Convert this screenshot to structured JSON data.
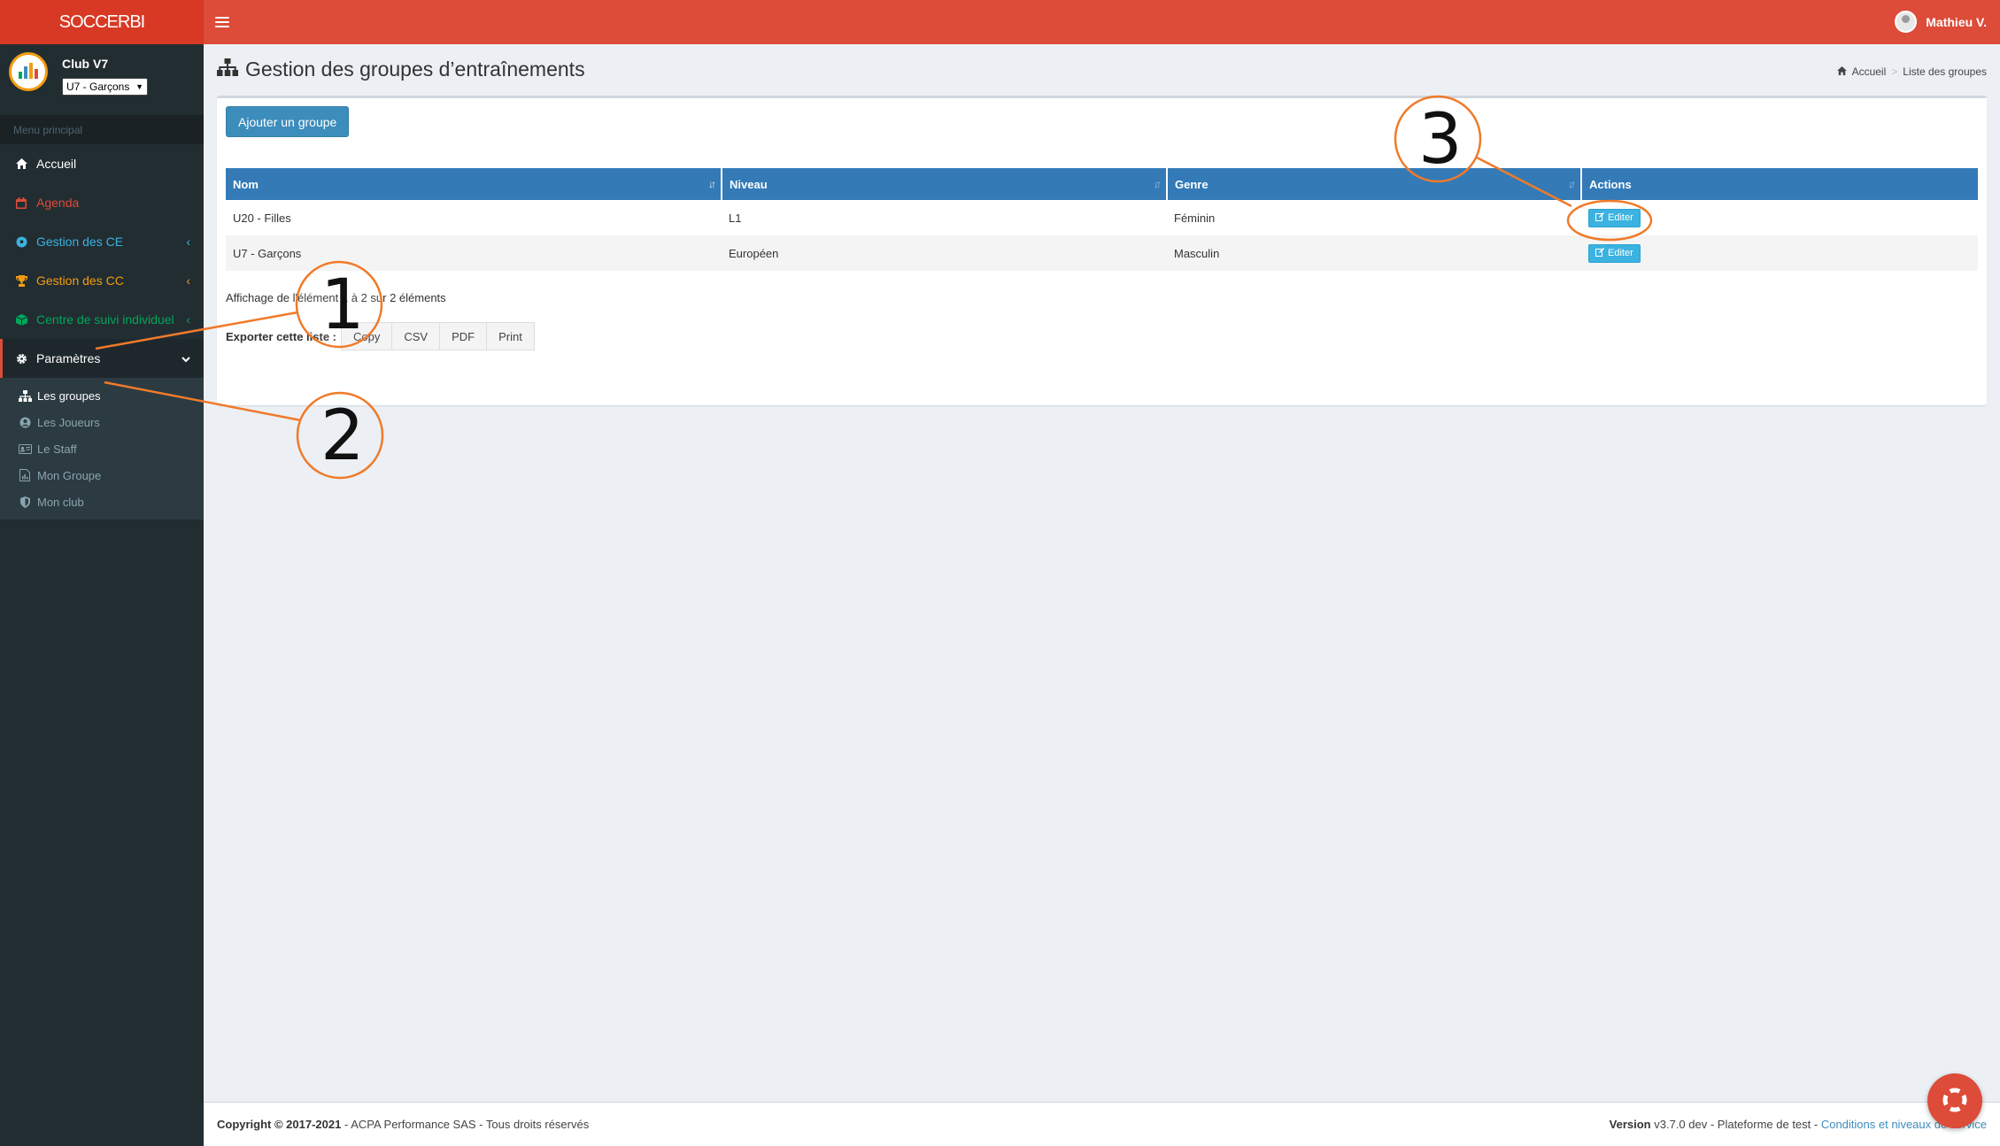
{
  "header": {
    "logo": "SOCCERBI",
    "user_name": "Mathieu V."
  },
  "sidebar": {
    "club_name": "Club V7",
    "team_select": "U7 - Garçons",
    "menu_header": "Menu principal",
    "items": [
      {
        "label": "Accueil",
        "icon": "home-icon",
        "color": "#ffffff"
      },
      {
        "label": "Agenda",
        "icon": "calendar-icon",
        "color": "#dd4b39"
      },
      {
        "label": "Gestion des CE",
        "icon": "soccer-ball-icon",
        "color": "#3bb2e0"
      },
      {
        "label": "Gestion des CC",
        "icon": "trophy-icon",
        "color": "#f39c12"
      },
      {
        "label": "Centre de suivi individuel",
        "icon": "cube-icon",
        "color": "#00a65a"
      },
      {
        "label": "Paramètres",
        "icon": "gear-icon",
        "color": "#ffffff"
      }
    ],
    "submenu": [
      {
        "label": "Les groupes",
        "icon": "sitemap-icon"
      },
      {
        "label": "Les Joueurs",
        "icon": "user-circle-icon"
      },
      {
        "label": "Le Staff",
        "icon": "id-card-icon"
      },
      {
        "label": "Mon Groupe",
        "icon": "chart-file-icon"
      },
      {
        "label": "Mon club",
        "icon": "shield-icon"
      }
    ]
  },
  "page": {
    "title": "Gestion des groupes d’entraînements",
    "breadcrumb": [
      "Accueil",
      "Liste des groupes"
    ],
    "add_button": "Ajouter un groupe"
  },
  "table": {
    "columns": [
      "Nom",
      "Niveau",
      "Genre",
      "Actions"
    ],
    "rows": [
      {
        "nom": "U20 - Filles",
        "niveau": "L1",
        "genre": "Féminin",
        "action": "Editer"
      },
      {
        "nom": "U7 - Garçons",
        "niveau": "Européen",
        "genre": "Masculin",
        "action": "Editer"
      }
    ],
    "info": "Affichage de l'élément 1 à 2 sur 2 éléments"
  },
  "export": {
    "label": "Exporter cette liste :",
    "buttons": [
      "Copy",
      "CSV",
      "PDF",
      "Print"
    ]
  },
  "footer": {
    "copyright_bold": "Copyright © 2017-2021",
    "copyright_rest": " - ACPA Performance SAS - Tous droits réservés",
    "version_bold": "Version",
    "version_rest": " v3.7.0 dev - Plateforme de test - ",
    "link": "Conditions et niveaux de service"
  },
  "annotations": [
    "1",
    "2",
    "3"
  ],
  "colors": {
    "brand": "#dd4b39",
    "sidebar": "#222d32",
    "primary": "#3c8dbc",
    "table_header": "#337ab7",
    "annotation": "#f07a2a"
  }
}
